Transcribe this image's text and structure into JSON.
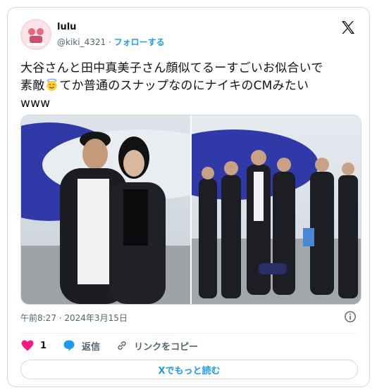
{
  "tweet": {
    "author_name": "lulu",
    "author_handle": "@kiki_4321",
    "separator": " · ",
    "follow_label": "フォローする",
    "text_line1": "大谷さんと田中真美子さん顔似てるーすごいお似合いで",
    "text_line2_a": "素敵",
    "text_line2_b": "てか普通のスナップなのにナイキのCMみたい",
    "text_line3": "www",
    "timestamp": "午前8:27 · 2024年3月15日",
    "like_count": "1",
    "reply_label": "返信",
    "copy_link_label": "リンクをコピー",
    "read_more_label": "Xでもっと読む"
  },
  "colors": {
    "accent": "#1d9bf0",
    "like": "#f91880",
    "muted": "#536471"
  }
}
